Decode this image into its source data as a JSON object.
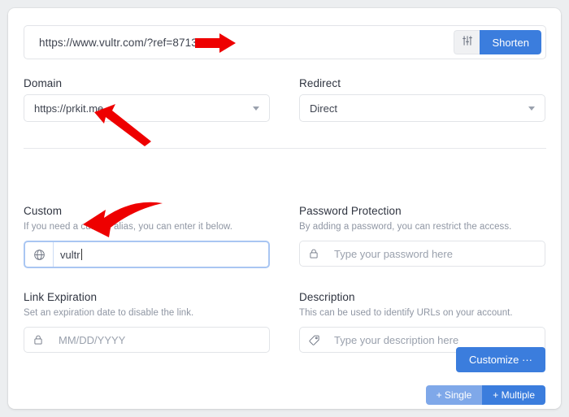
{
  "url_row": {
    "url_value": "https://www.vultr.com/?ref=8713550",
    "advanced_icon": "sliders-icon",
    "shorten_label": "Shorten",
    "accent_color": "#3b7ddd"
  },
  "fields": {
    "domain": {
      "label": "Domain",
      "value": "https://prkit.me",
      "caret_icon": "chevron-down-icon"
    },
    "redirect": {
      "label": "Redirect",
      "value": "Direct",
      "caret_icon": "chevron-down-icon"
    },
    "custom": {
      "label": "Custom",
      "hint": "If you need a custom alias, you can enter it below.",
      "value": "vultr",
      "icon": "globe-icon",
      "focus_border_color": "#a9c6f2"
    },
    "password": {
      "label": "Password Protection",
      "hint": "By adding a password, you can restrict the access.",
      "placeholder": "Type your password here",
      "icon": "lock-icon"
    },
    "expiration": {
      "label": "Link Expiration",
      "hint": "Set an expiration date to disable the link.",
      "placeholder": "MM/DD/YYYY",
      "icon": "lock-icon"
    },
    "description": {
      "label": "Description",
      "hint": "This can be used to identify URLs on your account.",
      "placeholder": "Type your description here",
      "icon": "tag-icon"
    }
  },
  "actions": {
    "customize_label": "Customize ···",
    "single_label": "+ Single",
    "multiple_label": "+ Multiple",
    "single_color": "#7fa8e9",
    "multiple_color": "#3b7ddd"
  },
  "annotations": {
    "color": "#ee0000",
    "arrow_1": "arrow-pointing-to-url",
    "arrow_2": "arrow-pointing-to-domain",
    "arrow_3": "arrow-pointing-to-custom-alias"
  }
}
